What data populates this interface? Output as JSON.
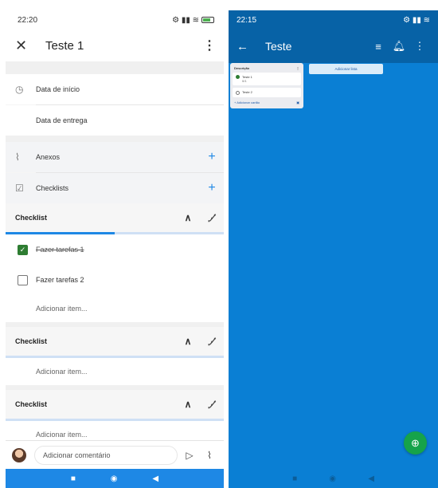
{
  "left": {
    "status": {
      "time": "22:20",
      "icons": "⚙ ▮▮ ≋"
    },
    "header": {
      "close": "✕",
      "title": "Teste 1",
      "more": "⋮"
    },
    "rows": {
      "start_date": "Data de início",
      "due_date": "Data de entrega",
      "attachments": "Anexos",
      "checklists": "Checklists"
    },
    "checklist1": {
      "title": "Checklist",
      "progress_percent": 50,
      "items": [
        {
          "label": "Fazer tarefas 1",
          "checked": true
        },
        {
          "label": "Fazer tarefas 2",
          "checked": false
        }
      ],
      "add_item": "Adicionar item..."
    },
    "checklist2": {
      "title": "Checklist",
      "add_item": "Adicionar item..."
    },
    "checklist3": {
      "title": "Checklist",
      "add_item": "Adicionar item..."
    },
    "comment": {
      "placeholder": "Adicionar comentário"
    }
  },
  "right": {
    "status": {
      "time": "22:15",
      "icons": "⚙ ▮▮ ≋"
    },
    "header": {
      "back": "←",
      "title": "Teste"
    },
    "list": {
      "title": "Descrição",
      "cards": [
        {
          "title": "Teste 1",
          "badge": "0/1",
          "done": true
        },
        {
          "title": "Teste 2",
          "done": false
        }
      ],
      "add_card": "+ Adicionar cartão"
    },
    "add_list": "Adicionar lista"
  },
  "colors": {
    "accent": "#1e88e5",
    "board": "#0a7fd4",
    "fab": "#16a34a",
    "check": "#2e7d32"
  }
}
